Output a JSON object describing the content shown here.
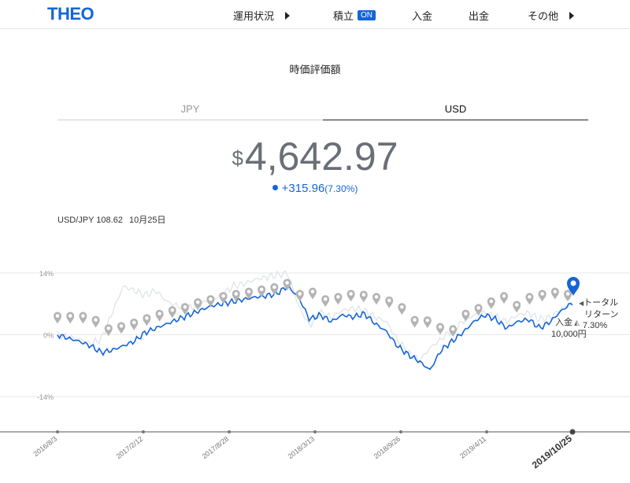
{
  "header": {
    "logo": "THEO",
    "nav": [
      {
        "label": "運用状況",
        "has_arrow": true
      },
      {
        "label": "積立",
        "badge": "ON"
      },
      {
        "label": "入金"
      },
      {
        "label": "出金"
      },
      {
        "label": "その他",
        "has_arrow": true
      }
    ]
  },
  "section_title": "時価評価額",
  "tabs": [
    {
      "label": "JPY",
      "active": false
    },
    {
      "label": "USD",
      "active": true
    }
  ],
  "valuation": {
    "currency": "$",
    "amount": "4,642.97",
    "change": "+315.96",
    "change_pct": "(7.30%)"
  },
  "fx": {
    "pair_label": "USD/JPY 108.62",
    "date": "10月25日"
  },
  "annotations": {
    "total_return_line1": "トータル",
    "total_return_line2": "リターン",
    "total_return_value": "7.30%",
    "deposit_label": "入金",
    "deposit_amount": "10,000円"
  },
  "colors": {
    "accent": "#1565d8",
    "marker": "#b3b3b3",
    "bench": "#dfe3ec"
  },
  "chart_data": {
    "type": "line",
    "y_ticks": [
      14,
      0,
      -14
    ],
    "y_tick_labels": [
      "14%",
      "0%",
      "-14%"
    ],
    "ylim": [
      -22,
      14
    ],
    "x_ticks": [
      "2016/8/3",
      "2017/2/12",
      "2017/8/28",
      "2018/3/13",
      "2018/9/26",
      "2019/4/11",
      "2019/10/25"
    ],
    "series": [
      {
        "values": [
          0,
          -0.8,
          -1.5,
          -2.5,
          -4,
          -3.5,
          -2.5,
          -1.5,
          0.5,
          1.5,
          2.5,
          3.5,
          4.5,
          5.5,
          6.5,
          7,
          7.5,
          8,
          8.5,
          8.8,
          9.3,
          11,
          8.5,
          3.5,
          4.5,
          3,
          4.5,
          4,
          4.8,
          2.5,
          0.8,
          -2.5,
          -4.5,
          -6,
          -8,
          -3.5,
          -1.5,
          0.5,
          3,
          4.5,
          3.5,
          1.5,
          3,
          3.5,
          1.5,
          3,
          5.5,
          7.3
        ]
      },
      {
        "values": [
          0,
          -0.5,
          -1,
          -2,
          -1,
          5,
          11,
          10,
          9,
          10,
          7.5,
          6.5,
          6,
          7,
          8,
          9,
          11,
          11.5,
          12.5,
          13,
          13.5,
          14,
          6.5,
          2,
          5,
          4,
          5.5,
          6,
          5.5,
          4,
          3,
          -1,
          -4,
          -6,
          -3,
          -1,
          1,
          3,
          4.5,
          5,
          4,
          3,
          4.5,
          5,
          3.5,
          4,
          6,
          7
        ]
      }
    ],
    "deposit_marker_values": [
      2.5,
      2.5,
      2.5,
      1.6,
      -0.3,
      0.2,
      1,
      2,
      3,
      3.8,
      4.5,
      5.6,
      6.3,
      7,
      7.5,
      8,
      8.5,
      9,
      10,
      7.5,
      8,
      6.3,
      6.8,
      7.5,
      7.3,
      6.8,
      6,
      4.5,
      1.6,
      1.5,
      0,
      -0.5,
      3,
      4.3,
      5.8,
      7,
      5,
      6.8,
      7.5,
      8,
      7.5
    ]
  }
}
